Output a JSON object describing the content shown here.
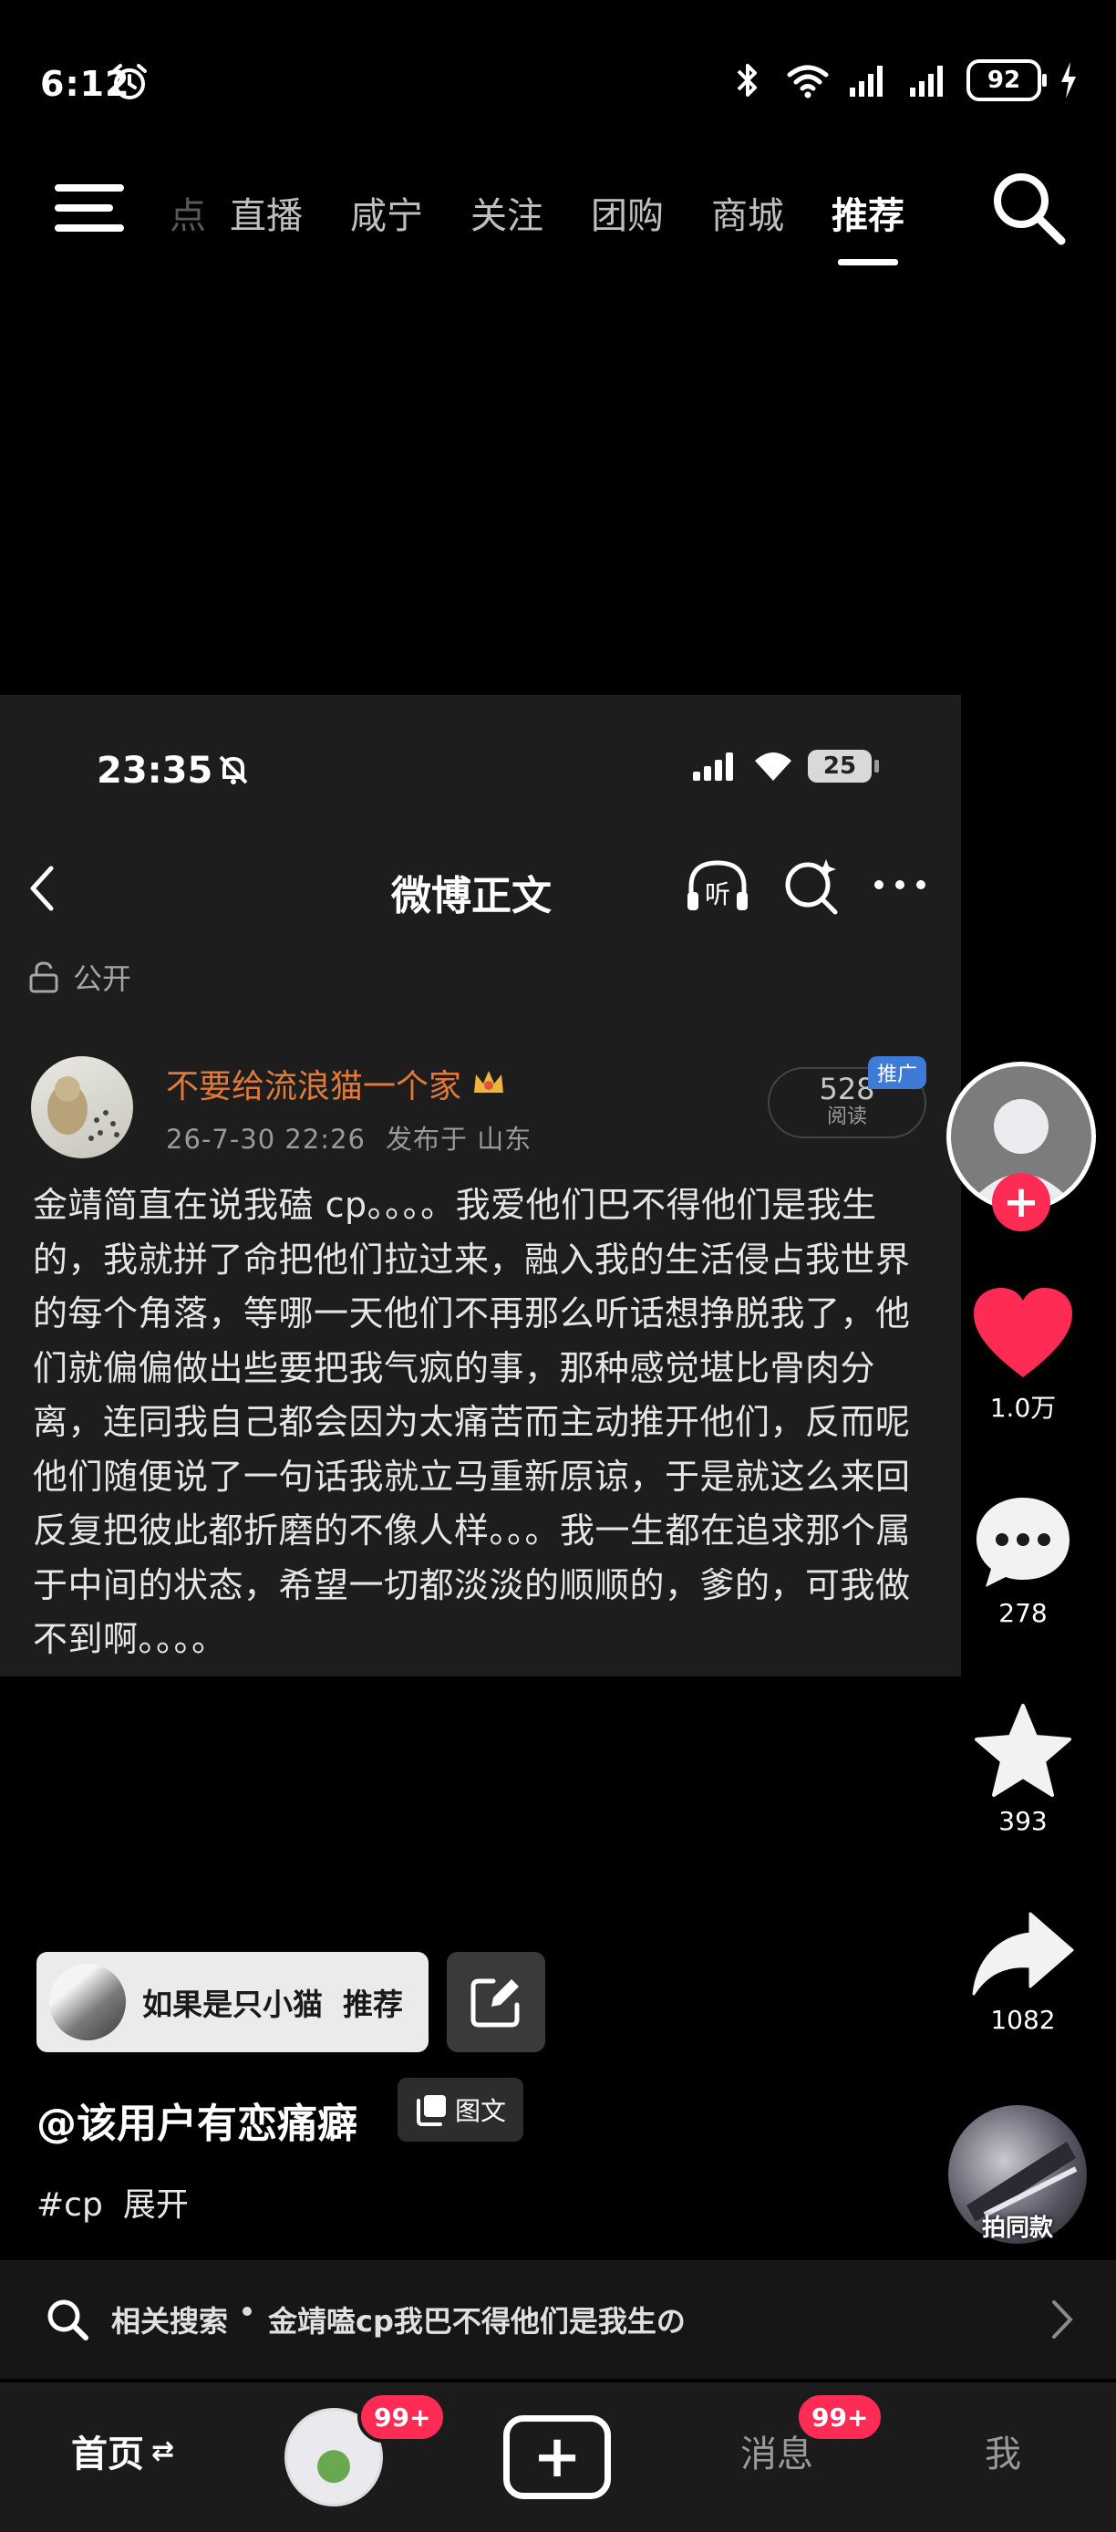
{
  "status_bar": {
    "time": "6:12",
    "battery": "92"
  },
  "top_nav": {
    "tabs": [
      {
        "label": "点",
        "state": "faded"
      },
      {
        "label": "直播",
        "state": "normal"
      },
      {
        "label": "咸宁",
        "state": "normal"
      },
      {
        "label": "关注",
        "state": "normal"
      },
      {
        "label": "团购",
        "state": "normal"
      },
      {
        "label": "商城",
        "state": "normal"
      },
      {
        "label": "推荐",
        "state": "active"
      }
    ]
  },
  "embedded_post": {
    "status_time": "23:35",
    "battery": "25",
    "title": "微博正文",
    "listen_label": "听",
    "visibility": "公开",
    "author_name": "不要给流浪猫一个家",
    "post_time": "26-7-30 22:26",
    "location": "发布于 山东",
    "read_count": "528",
    "read_label": "阅读",
    "promo_label": "推广",
    "body": "金靖简直在说我磕 cp。。。。我爱他们巴不得他们是我生的，我就拼了命把他们拉过来，融入我的生活侵占我世界的每个角落，等哪一天他们不再那么听话想挣脱我了，他们就偏偏做出些要把我气疯的事，那种感觉堪比骨肉分离，连同我自己都会因为太痛苦而主动推开他们，反而呢他们随便说了一句话我就立马重新原谅，于是就这么来回反复把彼此都折磨的不像人样。。。我一生都在追求那个属于中间的状态，希望一切都淡淡的顺顺的，爹的，可我做不到啊。。。。"
  },
  "actions": {
    "likes": "1.0万",
    "comments": "278",
    "favorites": "393",
    "shares": "1082",
    "follow_symbol": "+",
    "make_same_label": "拍同款"
  },
  "bottom_info": {
    "recommend_name": "如果是只小猫",
    "recommend_tag": "推荐",
    "author": "@该用户有恋痛癖",
    "content_type": "图文",
    "hashtag": "#cp",
    "expand": "展开"
  },
  "related": {
    "label": "相关搜索",
    "query": "金靖嗑cp我巴不得他们是我生の"
  },
  "bottom_nav": {
    "home": "首页",
    "home_swap": "⇄",
    "friends_badge": "99+",
    "create": "+",
    "messages": "消息",
    "messages_badge": "99+",
    "me": "我"
  },
  "colors": {
    "accent_red": "#fe2c55",
    "author_orange": "#e07a3a",
    "promo_blue": "#3d7bd6"
  }
}
